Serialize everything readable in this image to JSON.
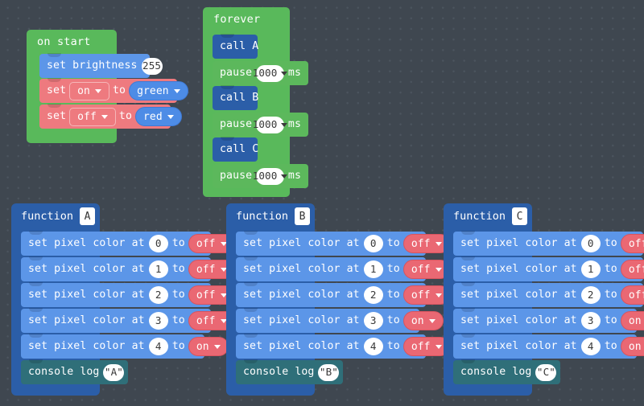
{
  "editor": {
    "name": "makecode-blocks-workspace",
    "background_color": "#3f4750"
  },
  "scripts": {
    "on_start": {
      "header": "on start",
      "statements": [
        {
          "kind": "set_brightness",
          "label": "set brightness",
          "value": "255"
        },
        {
          "kind": "set_var",
          "label": "set",
          "var": "on",
          "to": "to",
          "value": "green"
        },
        {
          "kind": "set_var",
          "label": "set",
          "var": "off",
          "to": "to",
          "value": "red"
        }
      ]
    },
    "forever": {
      "header": "forever",
      "statements": [
        {
          "kind": "call",
          "label": "call A"
        },
        {
          "kind": "pause",
          "label": "pause",
          "value": "1000",
          "unit": "ms"
        },
        {
          "kind": "call",
          "label": "call B"
        },
        {
          "kind": "pause",
          "label": "pause",
          "value": "1000",
          "unit": "ms"
        },
        {
          "kind": "call",
          "label": "call C"
        },
        {
          "kind": "pause",
          "label": "pause",
          "value": "1000",
          "unit": "ms"
        }
      ]
    },
    "functions": [
      {
        "header": "function",
        "name": "A",
        "rows": [
          {
            "prefix": "set pixel color at",
            "index": "0",
            "to": "to",
            "state": "off"
          },
          {
            "prefix": "set pixel color at",
            "index": "1",
            "to": "to",
            "state": "off"
          },
          {
            "prefix": "set pixel color at",
            "index": "2",
            "to": "to",
            "state": "off"
          },
          {
            "prefix": "set pixel color at",
            "index": "3",
            "to": "to",
            "state": "off"
          },
          {
            "prefix": "set pixel color at",
            "index": "4",
            "to": "to",
            "state": "on"
          }
        ],
        "log": {
          "label": "console log",
          "value": "\"A\""
        }
      },
      {
        "header": "function",
        "name": "B",
        "rows": [
          {
            "prefix": "set pixel color at",
            "index": "0",
            "to": "to",
            "state": "off"
          },
          {
            "prefix": "set pixel color at",
            "index": "1",
            "to": "to",
            "state": "off"
          },
          {
            "prefix": "set pixel color at",
            "index": "2",
            "to": "to",
            "state": "off"
          },
          {
            "prefix": "set pixel color at",
            "index": "3",
            "to": "to",
            "state": "on"
          },
          {
            "prefix": "set pixel color at",
            "index": "4",
            "to": "to",
            "state": "off"
          }
        ],
        "log": {
          "label": "console log",
          "value": "\"B\""
        }
      },
      {
        "header": "function",
        "name": "C",
        "rows": [
          {
            "prefix": "set pixel color at",
            "index": "0",
            "to": "to",
            "state": "off"
          },
          {
            "prefix": "set pixel color at",
            "index": "1",
            "to": "to",
            "state": "off"
          },
          {
            "prefix": "set pixel color at",
            "index": "2",
            "to": "to",
            "state": "off"
          },
          {
            "prefix": "set pixel color at",
            "index": "3",
            "to": "to",
            "state": "on"
          },
          {
            "prefix": "set pixel color at",
            "index": "4",
            "to": "to",
            "state": "on"
          }
        ],
        "log": {
          "label": "console log",
          "value": "\"C\""
        }
      }
    ]
  },
  "colors": {
    "event_green": "#5cb85c",
    "light_blue": "#5c96e8",
    "variable_red": "#ee7a7f",
    "function_blue": "#2b5ea8",
    "console_teal": "#2f6f79"
  }
}
